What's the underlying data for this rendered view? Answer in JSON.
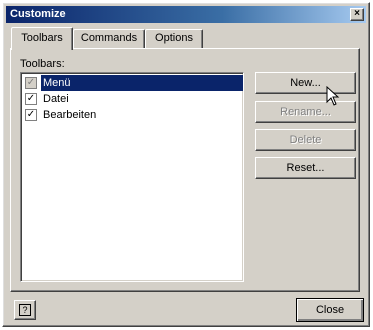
{
  "window": {
    "title": "Customize",
    "close_glyph": "×"
  },
  "tabs": [
    {
      "label": "Toolbars",
      "active": true
    },
    {
      "label": "Commands",
      "active": false
    },
    {
      "label": "Options",
      "active": false
    }
  ],
  "toolbars": {
    "label": "Toolbars:",
    "items": [
      {
        "label": "Menü",
        "checked": true,
        "selected": true
      },
      {
        "label": "Datei",
        "checked": true,
        "selected": false
      },
      {
        "label": "Bearbeiten",
        "checked": true,
        "selected": false
      }
    ]
  },
  "buttons": {
    "new": "New...",
    "rename": "Rename...",
    "delete": "Delete",
    "reset": "Reset...",
    "close": "Close",
    "help_glyph": "?"
  },
  "colors": {
    "titlebar": "#0a246a",
    "selection": "#0a246a",
    "face": "#d4d0c8"
  }
}
